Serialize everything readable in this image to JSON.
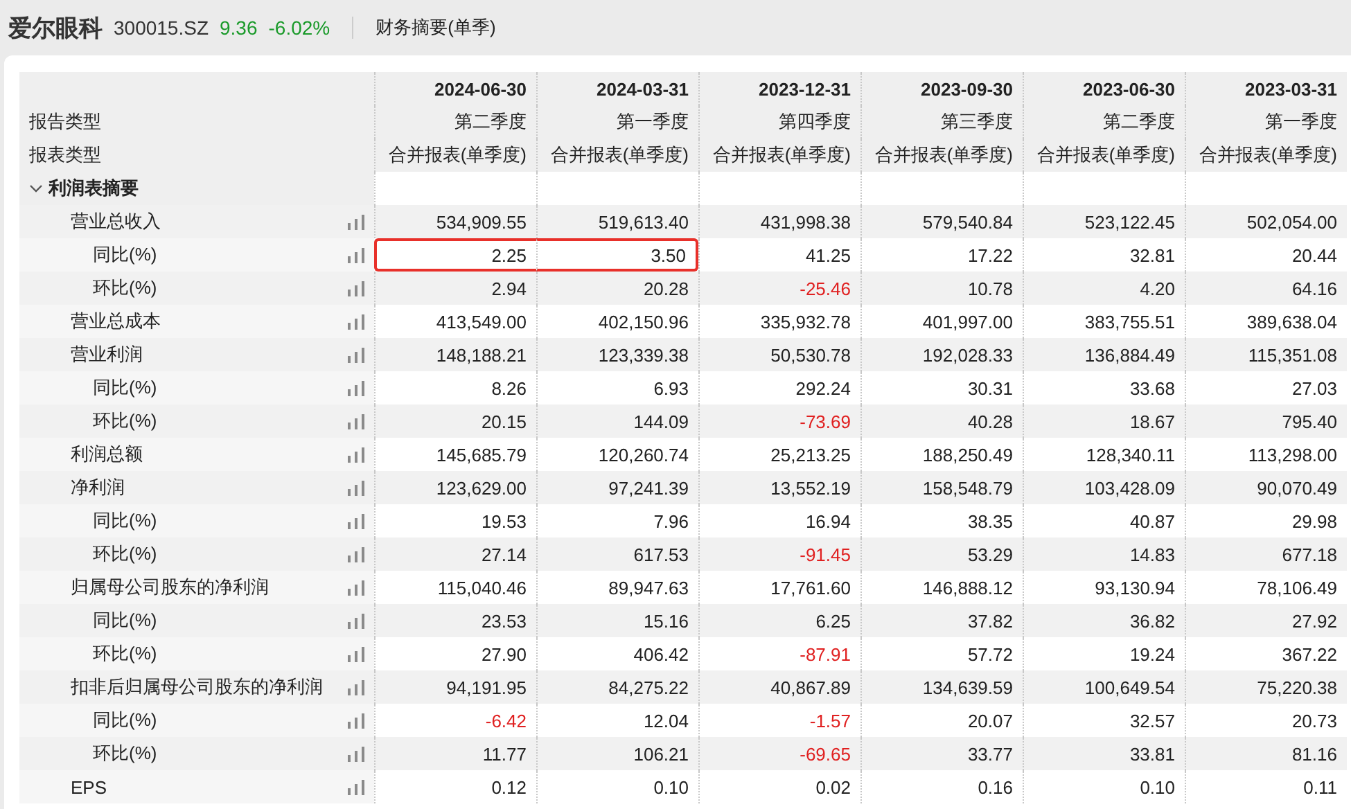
{
  "header": {
    "name": "爱尔眼科",
    "code": "300015.SZ",
    "price": "9.36",
    "change": "-6.02%",
    "falling": true,
    "view": "财务摘要(单季)"
  },
  "table": {
    "label_headers": [
      "报告类型",
      "报表类型"
    ],
    "columns": [
      {
        "date": "2024-06-30",
        "period": "第二季度",
        "report": "合并报表(单季度)"
      },
      {
        "date": "2024-03-31",
        "period": "第一季度",
        "report": "合并报表(单季度)"
      },
      {
        "date": "2023-12-31",
        "period": "第四季度",
        "report": "合并报表(单季度)"
      },
      {
        "date": "2023-09-30",
        "period": "第三季度",
        "report": "合并报表(单季度)"
      },
      {
        "date": "2023-06-30",
        "period": "第二季度",
        "report": "合并报表(单季度)"
      },
      {
        "date": "2023-03-31",
        "period": "第一季度",
        "report": "合并报表(单季度)"
      }
    ],
    "sections": [
      {
        "title": "利润表摘要",
        "expanded": true,
        "rows": [
          {
            "label": "营业总收入",
            "cells": [
              {
                "v": "534,909.55",
                "negative": false,
                "selected": false
              },
              {
                "v": "519,613.40",
                "negative": false,
                "selected": false
              },
              {
                "v": "431,998.38",
                "negative": false,
                "selected": false
              },
              {
                "v": "579,540.84",
                "negative": false,
                "selected": false
              },
              {
                "v": "523,122.45",
                "negative": false,
                "selected": false
              },
              {
                "v": "502,054.00",
                "negative": false,
                "selected": false
              }
            ],
            "children": [
              {
                "label": "同比(%)",
                "cells": [
                  {
                    "v": "2.25",
                    "negative": false,
                    "selected": true
                  },
                  {
                    "v": "3.50",
                    "negative": false,
                    "selected": true
                  },
                  {
                    "v": "41.25",
                    "negative": false,
                    "selected": false
                  },
                  {
                    "v": "17.22",
                    "negative": false,
                    "selected": false
                  },
                  {
                    "v": "32.81",
                    "negative": false,
                    "selected": false
                  },
                  {
                    "v": "20.44",
                    "negative": false,
                    "selected": false
                  }
                ]
              },
              {
                "label": "环比(%)",
                "cells": [
                  {
                    "v": "2.94",
                    "negative": false,
                    "selected": false
                  },
                  {
                    "v": "20.28",
                    "negative": false,
                    "selected": false
                  },
                  {
                    "v": "-25.46",
                    "negative": true,
                    "selected": false
                  },
                  {
                    "v": "10.78",
                    "negative": false,
                    "selected": false
                  },
                  {
                    "v": "4.20",
                    "negative": false,
                    "selected": false
                  },
                  {
                    "v": "64.16",
                    "negative": false,
                    "selected": false
                  }
                ]
              }
            ]
          },
          {
            "label": "营业总成本",
            "cells": [
              {
                "v": "413,549.00",
                "negative": false,
                "selected": false
              },
              {
                "v": "402,150.96",
                "negative": false,
                "selected": false
              },
              {
                "v": "335,932.78",
                "negative": false,
                "selected": false
              },
              {
                "v": "401,997.00",
                "negative": false,
                "selected": false
              },
              {
                "v": "383,755.51",
                "negative": false,
                "selected": false
              },
              {
                "v": "389,638.04",
                "negative": false,
                "selected": false
              }
            ]
          },
          {
            "label": "营业利润",
            "cells": [
              {
                "v": "148,188.21",
                "negative": false,
                "selected": false
              },
              {
                "v": "123,339.38",
                "negative": false,
                "selected": false
              },
              {
                "v": "50,530.78",
                "negative": false,
                "selected": false
              },
              {
                "v": "192,028.33",
                "negative": false,
                "selected": false
              },
              {
                "v": "136,884.49",
                "negative": false,
                "selected": false
              },
              {
                "v": "115,351.08",
                "negative": false,
                "selected": false
              }
            ],
            "children": [
              {
                "label": "同比(%)",
                "cells": [
                  {
                    "v": "8.26",
                    "negative": false,
                    "selected": false
                  },
                  {
                    "v": "6.93",
                    "negative": false,
                    "selected": false
                  },
                  {
                    "v": "292.24",
                    "negative": false,
                    "selected": false
                  },
                  {
                    "v": "30.31",
                    "negative": false,
                    "selected": false
                  },
                  {
                    "v": "33.68",
                    "negative": false,
                    "selected": false
                  },
                  {
                    "v": "27.03",
                    "negative": false,
                    "selected": false
                  }
                ]
              },
              {
                "label": "环比(%)",
                "cells": [
                  {
                    "v": "20.15",
                    "negative": false,
                    "selected": false
                  },
                  {
                    "v": "144.09",
                    "negative": false,
                    "selected": false
                  },
                  {
                    "v": "-73.69",
                    "negative": true,
                    "selected": false
                  },
                  {
                    "v": "40.28",
                    "negative": false,
                    "selected": false
                  },
                  {
                    "v": "18.67",
                    "negative": false,
                    "selected": false
                  },
                  {
                    "v": "795.40",
                    "negative": false,
                    "selected": false
                  }
                ]
              }
            ]
          },
          {
            "label": "利润总额",
            "cells": [
              {
                "v": "145,685.79",
                "negative": false,
                "selected": false
              },
              {
                "v": "120,260.74",
                "negative": false,
                "selected": false
              },
              {
                "v": "25,213.25",
                "negative": false,
                "selected": false
              },
              {
                "v": "188,250.49",
                "negative": false,
                "selected": false
              },
              {
                "v": "128,340.11",
                "negative": false,
                "selected": false
              },
              {
                "v": "113,298.00",
                "negative": false,
                "selected": false
              }
            ]
          },
          {
            "label": "净利润",
            "cells": [
              {
                "v": "123,629.00",
                "negative": false,
                "selected": false
              },
              {
                "v": "97,241.39",
                "negative": false,
                "selected": false
              },
              {
                "v": "13,552.19",
                "negative": false,
                "selected": false
              },
              {
                "v": "158,548.79",
                "negative": false,
                "selected": false
              },
              {
                "v": "103,428.09",
                "negative": false,
                "selected": false
              },
              {
                "v": "90,070.49",
                "negative": false,
                "selected": false
              }
            ],
            "children": [
              {
                "label": "同比(%)",
                "cells": [
                  {
                    "v": "19.53",
                    "negative": false,
                    "selected": false
                  },
                  {
                    "v": "7.96",
                    "negative": false,
                    "selected": false
                  },
                  {
                    "v": "16.94",
                    "negative": false,
                    "selected": false
                  },
                  {
                    "v": "38.35",
                    "negative": false,
                    "selected": false
                  },
                  {
                    "v": "40.87",
                    "negative": false,
                    "selected": false
                  },
                  {
                    "v": "29.98",
                    "negative": false,
                    "selected": false
                  }
                ]
              },
              {
                "label": "环比(%)",
                "cells": [
                  {
                    "v": "27.14",
                    "negative": false,
                    "selected": false
                  },
                  {
                    "v": "617.53",
                    "negative": false,
                    "selected": false
                  },
                  {
                    "v": "-91.45",
                    "negative": true,
                    "selected": false
                  },
                  {
                    "v": "53.29",
                    "negative": false,
                    "selected": false
                  },
                  {
                    "v": "14.83",
                    "negative": false,
                    "selected": false
                  },
                  {
                    "v": "677.18",
                    "negative": false,
                    "selected": false
                  }
                ]
              }
            ]
          },
          {
            "label": "归属母公司股东的净利润",
            "cells": [
              {
                "v": "115,040.46",
                "negative": false,
                "selected": false
              },
              {
                "v": "89,947.63",
                "negative": false,
                "selected": false
              },
              {
                "v": "17,761.60",
                "negative": false,
                "selected": false
              },
              {
                "v": "146,888.12",
                "negative": false,
                "selected": false
              },
              {
                "v": "93,130.94",
                "negative": false,
                "selected": false
              },
              {
                "v": "78,106.49",
                "negative": false,
                "selected": false
              }
            ],
            "children": [
              {
                "label": "同比(%)",
                "cells": [
                  {
                    "v": "23.53",
                    "negative": false,
                    "selected": false
                  },
                  {
                    "v": "15.16",
                    "negative": false,
                    "selected": false
                  },
                  {
                    "v": "6.25",
                    "negative": false,
                    "selected": false
                  },
                  {
                    "v": "37.82",
                    "negative": false,
                    "selected": false
                  },
                  {
                    "v": "36.82",
                    "negative": false,
                    "selected": false
                  },
                  {
                    "v": "27.92",
                    "negative": false,
                    "selected": false
                  }
                ]
              },
              {
                "label": "环比(%)",
                "cells": [
                  {
                    "v": "27.90",
                    "negative": false,
                    "selected": false
                  },
                  {
                    "v": "406.42",
                    "negative": false,
                    "selected": false
                  },
                  {
                    "v": "-87.91",
                    "negative": true,
                    "selected": false
                  },
                  {
                    "v": "57.72",
                    "negative": false,
                    "selected": false
                  },
                  {
                    "v": "19.24",
                    "negative": false,
                    "selected": false
                  },
                  {
                    "v": "367.22",
                    "negative": false,
                    "selected": false
                  }
                ]
              }
            ]
          },
          {
            "label": "扣非后归属母公司股东的净利润",
            "cells": [
              {
                "v": "94,191.95",
                "negative": false,
                "selected": false
              },
              {
                "v": "84,275.22",
                "negative": false,
                "selected": false
              },
              {
                "v": "40,867.89",
                "negative": false,
                "selected": false
              },
              {
                "v": "134,639.59",
                "negative": false,
                "selected": false
              },
              {
                "v": "100,649.54",
                "negative": false,
                "selected": false
              },
              {
                "v": "75,220.38",
                "negative": false,
                "selected": false
              }
            ],
            "children": [
              {
                "label": "同比(%)",
                "cells": [
                  {
                    "v": "-6.42",
                    "negative": true,
                    "selected": false
                  },
                  {
                    "v": "12.04",
                    "negative": false,
                    "selected": false
                  },
                  {
                    "v": "-1.57",
                    "negative": true,
                    "selected": false
                  },
                  {
                    "v": "20.07",
                    "negative": false,
                    "selected": false
                  },
                  {
                    "v": "32.57",
                    "negative": false,
                    "selected": false
                  },
                  {
                    "v": "20.73",
                    "negative": false,
                    "selected": false
                  }
                ]
              },
              {
                "label": "环比(%)",
                "cells": [
                  {
                    "v": "11.77",
                    "negative": false,
                    "selected": false
                  },
                  {
                    "v": "106.21",
                    "negative": false,
                    "selected": false
                  },
                  {
                    "v": "-69.65",
                    "negative": true,
                    "selected": false
                  },
                  {
                    "v": "33.77",
                    "negative": false,
                    "selected": false
                  },
                  {
                    "v": "33.81",
                    "negative": false,
                    "selected": false
                  },
                  {
                    "v": "81.16",
                    "negative": false,
                    "selected": false
                  }
                ]
              }
            ]
          },
          {
            "label": "EPS",
            "cells": [
              {
                "v": "0.12",
                "negative": false,
                "selected": false
              },
              {
                "v": "0.10",
                "negative": false,
                "selected": false
              },
              {
                "v": "0.02",
                "negative": false,
                "selected": false
              },
              {
                "v": "0.16",
                "negative": false,
                "selected": false
              },
              {
                "v": "0.10",
                "negative": false,
                "selected": false
              },
              {
                "v": "0.11",
                "negative": false,
                "selected": false
              }
            ]
          }
        ]
      }
    ]
  }
}
